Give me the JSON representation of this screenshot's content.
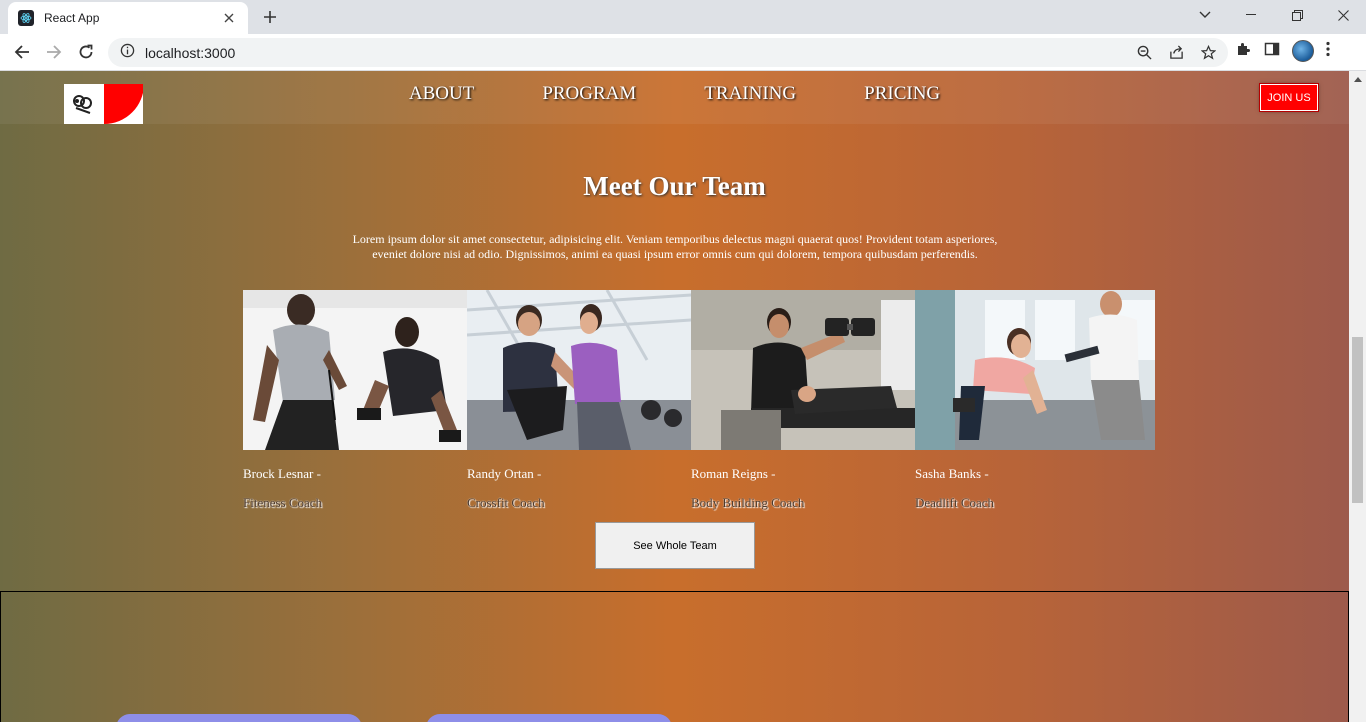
{
  "browser": {
    "tab_title": "React App",
    "url": "localhost:3000"
  },
  "site": {
    "nav_links": [
      "ABOUT",
      "PROGRAM",
      "TRAINING",
      "PRICING"
    ],
    "join_label": "JOIN US"
  },
  "team": {
    "title": "Meet Our Team",
    "description": "Lorem ipsum dolor sit amet consectetur, adipisicing elit. Veniam temporibus delectus magni quaerat quos! Provident totam asperiores, eveniet dolore nisi ad odio. Dignissimos, animi ea quasi ipsum error omnis cum qui dolorem, tempora quibusdam perferendis.",
    "members": [
      {
        "name": "Brock Lesnar -",
        "role": "Fiteness Coach"
      },
      {
        "name": "Randy Ortan -",
        "role": "Crossfit Coach"
      },
      {
        "name": "Roman Reigns -",
        "role": "Body Building Coach"
      },
      {
        "name": "Sasha Banks -",
        "role": "Deadlift Coach"
      }
    ],
    "see_all_label": "See Whole Team"
  },
  "colors": {
    "join_bg": "#ff0000",
    "gradient_mid": "#c86e2c",
    "pill": "#8e8ee8"
  }
}
